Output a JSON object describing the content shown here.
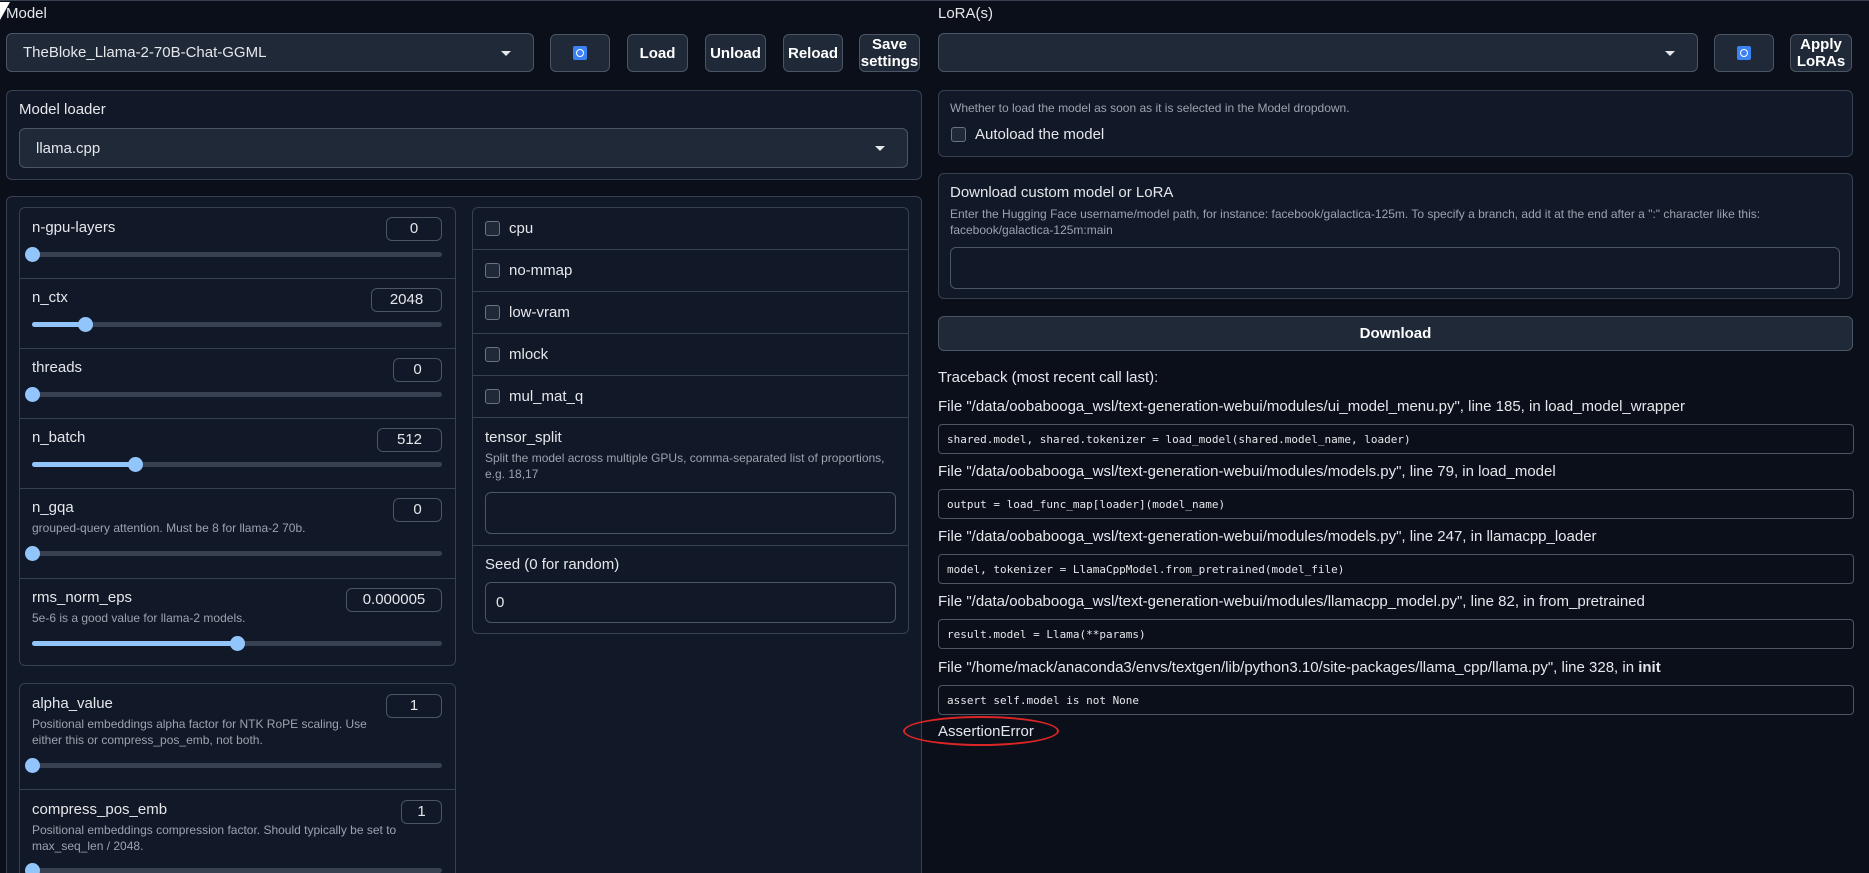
{
  "model_section": {
    "label": "Model",
    "selected": "TheBloke_Llama-2-70B-Chat-GGML",
    "buttons": {
      "load": "Load",
      "unload": "Unload",
      "reload": "Reload",
      "save_line1": "Save",
      "save_line2": "settings"
    }
  },
  "lora_section": {
    "label": "LoRA(s)",
    "selected": "",
    "apply_line1": "Apply",
    "apply_line2": "LoRAs"
  },
  "model_loader": {
    "label": "Model loader",
    "selected": "llama.cpp"
  },
  "sliders": [
    {
      "label": "n-gpu-layers",
      "value": "0",
      "fraction": 0.0
    },
    {
      "label": "n_ctx",
      "value": "2048",
      "fraction": 0.13
    },
    {
      "label": "threads",
      "value": "0",
      "fraction": 0.0
    },
    {
      "label": "n_batch",
      "value": "512",
      "fraction": 0.25
    },
    {
      "label": "n_gqa",
      "info": "grouped-query attention. Must be 8 for llama-2 70b.",
      "value": "0",
      "fraction": 0.0
    },
    {
      "label": "rms_norm_eps",
      "info": "5e-6 is a good value for llama-2 models.",
      "value": "0.000005",
      "fraction": 0.5
    }
  ],
  "sliders2": [
    {
      "label": "alpha_value",
      "info_line1": "Positional embeddings alpha factor for NTK RoPE scaling. Use",
      "info_line2": "either this or compress_pos_emb, not both.",
      "value": "1",
      "fraction": 0.0
    },
    {
      "label": "compress_pos_emb",
      "info_line1": "Positional embeddings compression factor. Should typically be set to",
      "info_line2": "max_seq_len / 2048.",
      "value": "1",
      "fraction": 0.0
    }
  ],
  "checkboxes": [
    "cpu",
    "no-mmap",
    "low-vram",
    "mlock",
    "mul_mat_q"
  ],
  "tensor_split": {
    "label": "tensor_split",
    "info_line1": "Split the model across multiple GPUs, comma-separated list of proportions,",
    "info_line2": "e.g. 18,17",
    "value": ""
  },
  "seed": {
    "label": "Seed (0 for random)",
    "value": "0"
  },
  "autoload": {
    "info": "Whether to load the model as soon as it is selected in the Model dropdown.",
    "label": "Autoload the model"
  },
  "download": {
    "title": "Download custom model or LoRA",
    "info_line1": "Enter the Hugging Face username/model path, for instance: facebook/galactica-125m. To specify a branch, add it at the end after a \":\" character like this:",
    "info_line2": "facebook/galactica-125m:main",
    "value": "",
    "button": "Download"
  },
  "traceback": {
    "header": "Traceback (most recent call last):",
    "frames": [
      {
        "file": "File \"/data/oobabooga_wsl/text-generation-webui/modules/ui_model_menu.py\", line 185, in load_model_wrapper",
        "code": "shared.model, shared.tokenizer = load_model(shared.model_name, loader)"
      },
      {
        "file": "File \"/data/oobabooga_wsl/text-generation-webui/modules/models.py\", line 79, in load_model",
        "code": "output = load_func_map[loader](model_name)"
      },
      {
        "file": "File \"/data/oobabooga_wsl/text-generation-webui/modules/models.py\", line 247, in llamacpp_loader",
        "code": "model, tokenizer = LlamaCppModel.from_pretrained(model_file)"
      },
      {
        "file": "File \"/data/oobabooga_wsl/text-generation-webui/modules/llamacpp_model.py\", line 82, in from_pretrained",
        "code": "result.model = Llama(**params)"
      }
    ],
    "last_frame_prefix": "File \"/home/mack/anaconda3/envs/textgen/lib/python3.10/site-packages/llama_cpp/llama.py\", line 328, in ",
    "last_frame_bold": "init",
    "last_code": "assert self.model is not None",
    "error": "AssertionError"
  },
  "colors": {
    "background": "#0b0f19",
    "slider": "#93c5fd",
    "annotation": "#dc2626",
    "refresh": "#3b82f6"
  },
  "icons": [
    "cursor-icon",
    "refresh-icon",
    "chevron-down-icon"
  ]
}
